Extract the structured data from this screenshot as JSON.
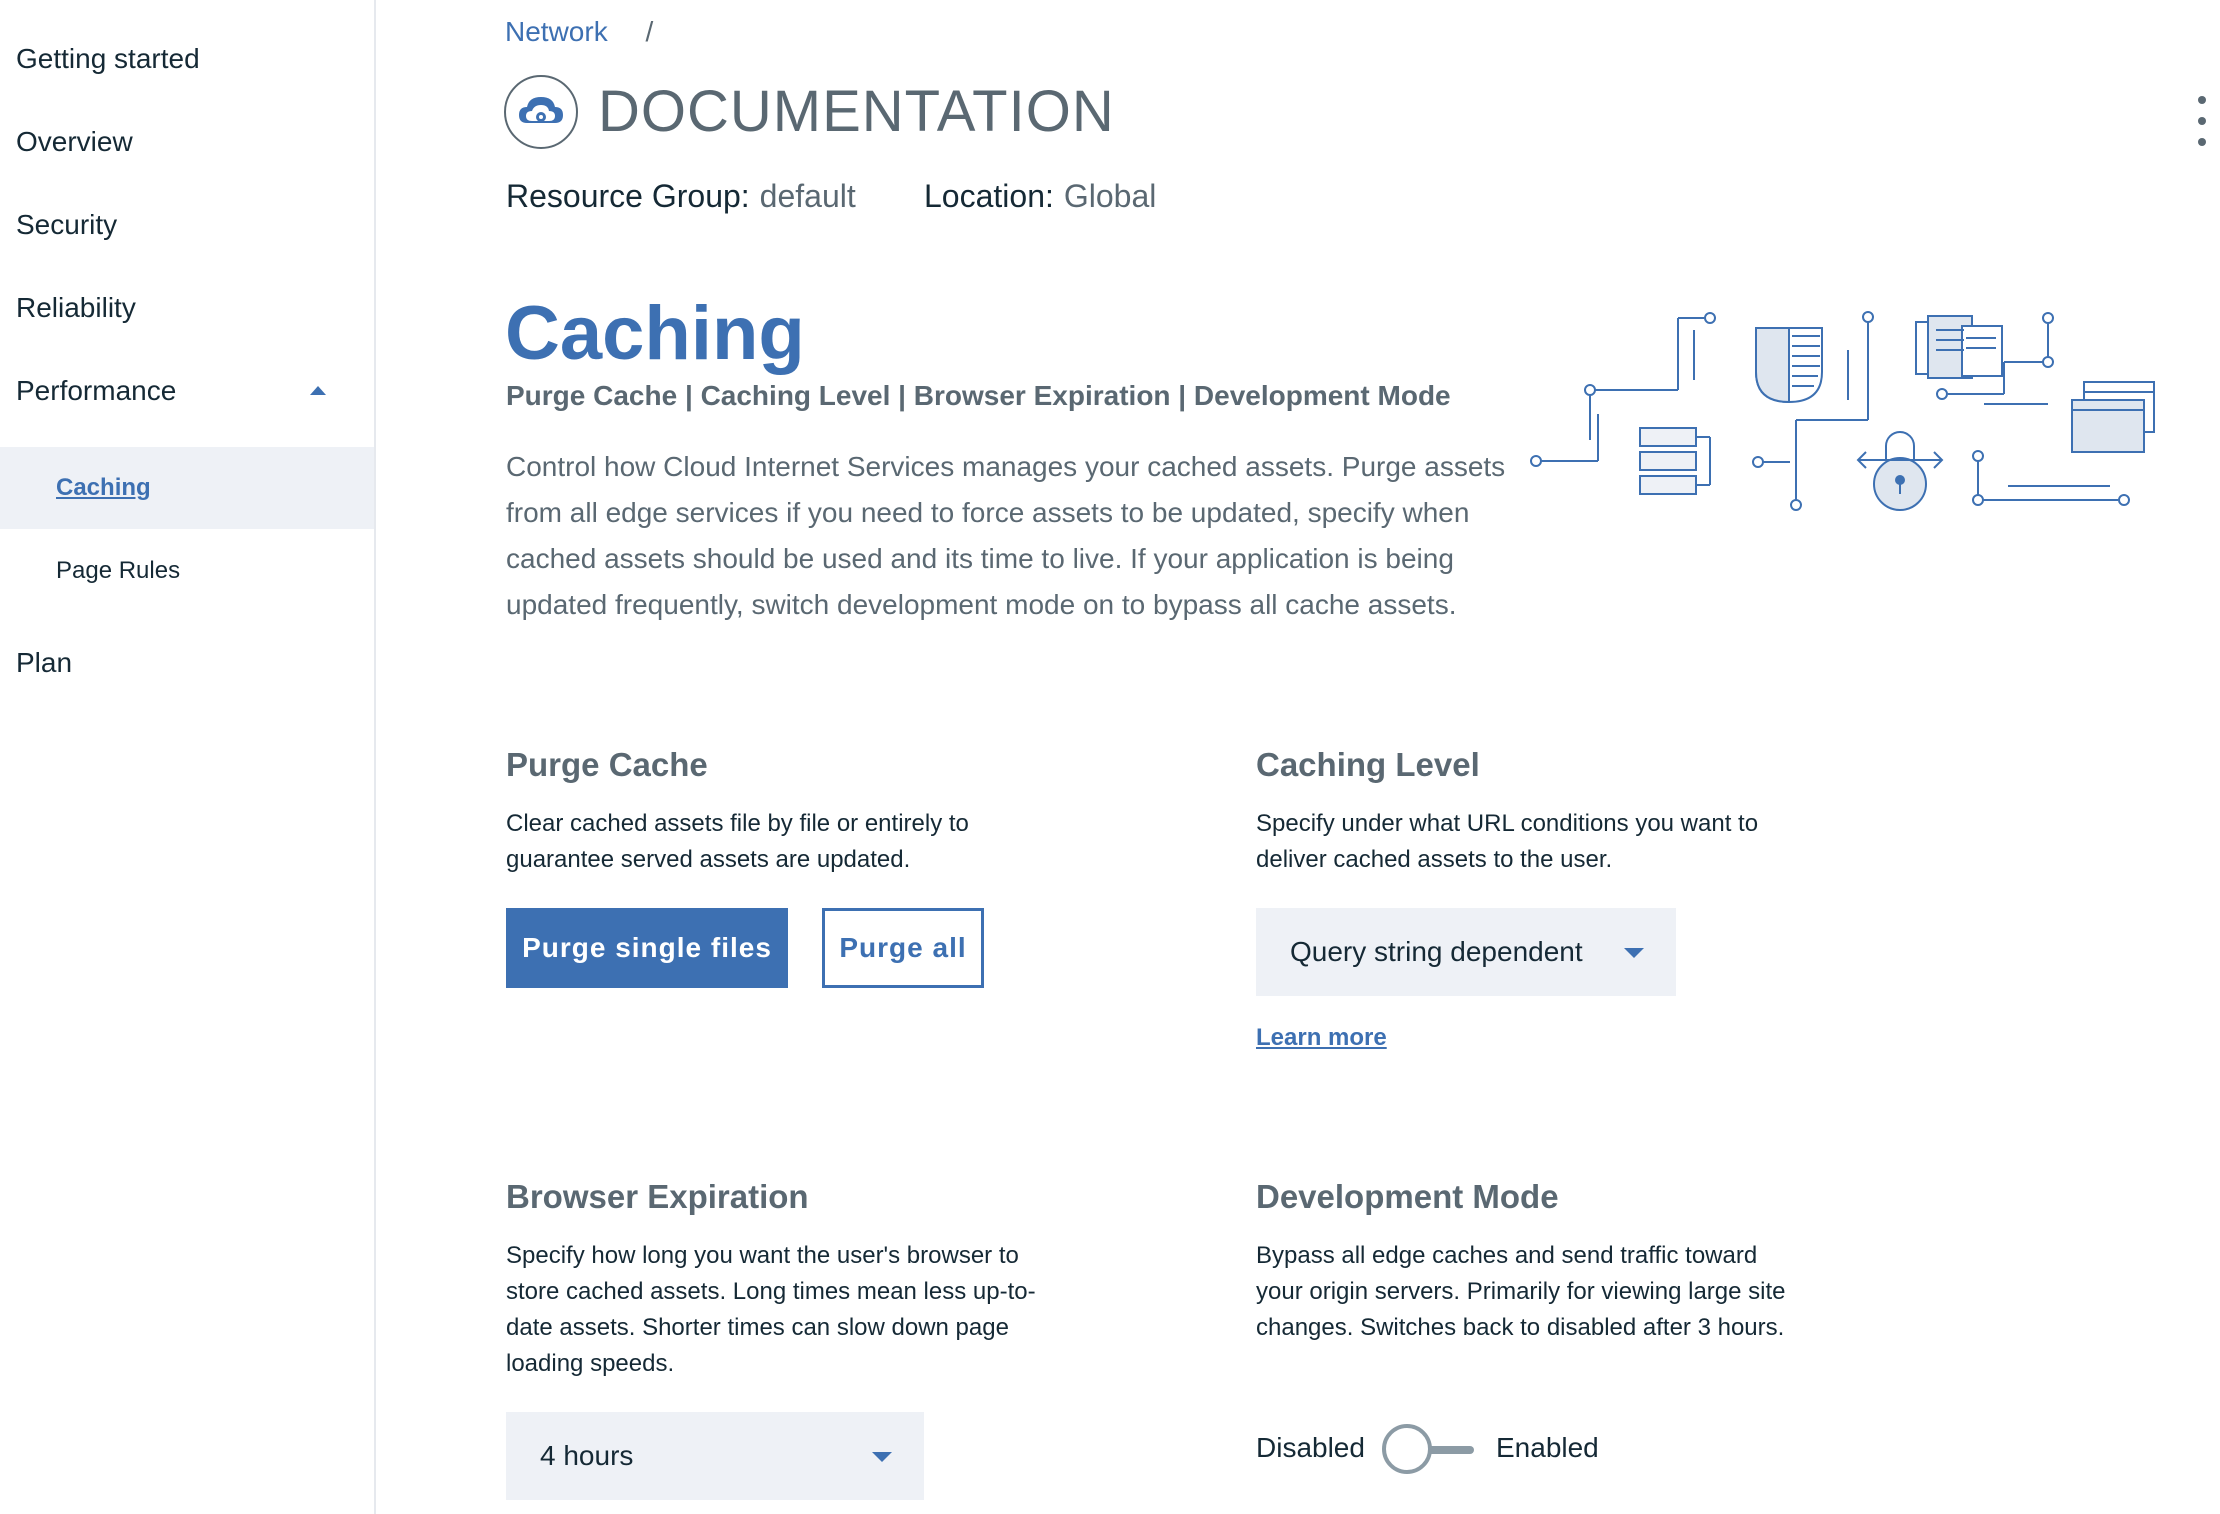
{
  "sidebar": {
    "items": [
      {
        "label": "Getting started"
      },
      {
        "label": "Overview"
      },
      {
        "label": "Security"
      },
      {
        "label": "Reliability"
      },
      {
        "label": "Performance"
      },
      {
        "label": "Plan"
      }
    ],
    "sub_items": [
      {
        "label": "Caching",
        "active": true
      },
      {
        "label": "Page Rules",
        "active": false
      }
    ]
  },
  "header": {
    "breadcrumb": "Network",
    "breadcrumb_sep": "/",
    "title": "DOCUMENTATION",
    "resource_group_label": "Resource Group:",
    "resource_group_value": "default",
    "location_label": "Location:",
    "location_value": "Global"
  },
  "section": {
    "title": "Caching",
    "links": "Purge Cache | Caching Level | Browser Expiration | Development Mode",
    "description": "Control how Cloud Internet Services manages your cached assets. Purge assets from all edge services if you need to force assets to be updated, specify when cached assets should be used and its time to live. If your application is being updated frequently, switch development mode on to bypass all cache assets."
  },
  "purge_cache": {
    "title": "Purge Cache",
    "description": "Clear cached assets file by file or entirely to guarantee served assets are updated.",
    "primary_button": "Purge single files",
    "secondary_button": "Purge all"
  },
  "caching_level": {
    "title": "Caching Level",
    "description": "Specify under what URL conditions you want to deliver cached assets to the user.",
    "selected": "Query string dependent",
    "link": "Learn more"
  },
  "browser_expiration": {
    "title": "Browser Expiration",
    "description": "Specify how long you want the user's browser to store cached assets. Long times mean less up-to-date assets. Shorter times can slow down page loading speeds.",
    "selected": "4 hours"
  },
  "development_mode": {
    "title": "Development Mode",
    "description": "Bypass all edge caches and send traffic toward your origin servers. Primarily for viewing large site changes. Switches back to disabled after 3 hours.",
    "off_label": "Disabled",
    "on_label": "Enabled",
    "enabled": false
  },
  "colors": {
    "accent": "#3d70b2",
    "text": "#152935",
    "muted": "#5a6872",
    "field_bg": "#eef1f6"
  }
}
